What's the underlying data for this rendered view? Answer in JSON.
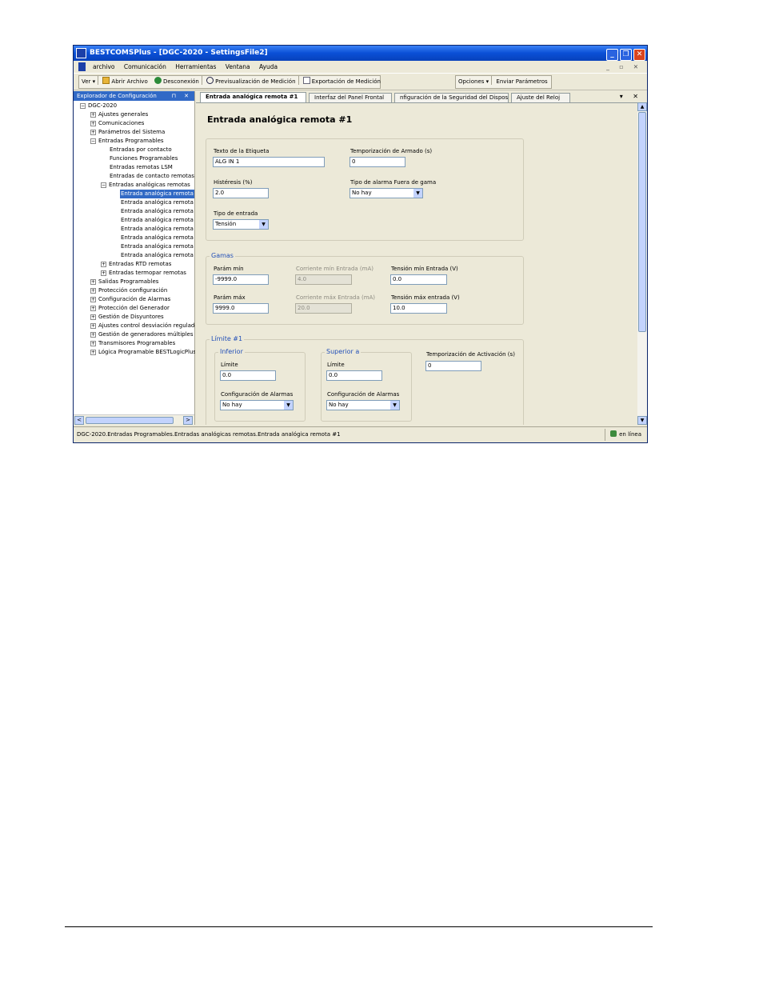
{
  "window": {
    "title": "BESTCOMSPlus - [DGC-2020 - SettingsFile2]",
    "controls": [
      "_",
      "❐",
      "✕"
    ]
  },
  "menu": {
    "items": [
      "archivo",
      "Comunicación",
      "Herramientas",
      "Ventana",
      "Ayuda"
    ],
    "mdi_controls": "_ ▫ ✕"
  },
  "toolbar": {
    "view": "Ver ▾",
    "open_file": "Abrir Archivo",
    "disconnect": "Desconexión",
    "preview": "Previsualización de Medición",
    "export": "Exportación de Medición",
    "options": "Opciones ▾",
    "send": "Enviar Parámetros"
  },
  "explorer": {
    "title": "Explorador de Configuración",
    "pin": "⊓ ✕",
    "nodes": [
      "DGC-2020",
      "Ajustes generales",
      "Comunicaciones",
      "Parámetros del Sistema",
      "Entradas Programables",
      "Entradas por contacto",
      "Funciones Programables",
      "Entradas remotas LSM",
      "Entradas de contacto remotas",
      "Entradas analógicas remotas",
      "Entrada analógica remota",
      "Entrada analógica remota",
      "Entrada analógica remota",
      "Entrada analógica remota",
      "Entrada analógica remota",
      "Entrada analógica remota",
      "Entrada analógica remota",
      "Entrada analógica remota",
      "Entradas RTD remotas",
      "Entradas termopar remotas",
      "Salidas Programables",
      "Protección configuración",
      "Configuración de Alarmas",
      "Protección del Generador",
      "Gestión de Disyuntores",
      "Ajustes control desviación regulado",
      "Gestión de generadores múltiples",
      "Transmisores Programables",
      "Lógica Programable BESTLogicPlus"
    ],
    "scroll_left": "<",
    "scroll_right": ">"
  },
  "tabs": {
    "items": [
      "Entrada analógica remota #1",
      "Interfaz del Panel Frontal",
      "nfiguración de la Seguridad del Dispositi",
      "Ajuste del Reloj"
    ],
    "controls": "▾ ✕"
  },
  "form": {
    "title": "Entrada analógica remota #1",
    "label_text_label": "Texto de la Etiqueta",
    "label_text_value": "ALG IN 1",
    "arm_delay_label": "Temporización de Armado (s)",
    "arm_delay_value": "0",
    "hysteresis_label": "Histéresis (%)",
    "hysteresis_value": "2.0",
    "oor_alarm_label": "Tipo de alarma Fuera de gama",
    "oor_alarm_value": "No hay",
    "input_type_label": "Tipo de entrada",
    "input_type_value": "Tensión",
    "ranges": {
      "title": "Gamas",
      "param_min_label": "Parám mín",
      "param_min_value": "-9999.0",
      "current_min_label": "Corriente mín Entrada (mA)",
      "current_min_value": "4.0",
      "voltage_min_label": "Tensión mín Entrada (V)",
      "voltage_min_value": "0.0",
      "param_max_label": "Parám máx",
      "param_max_value": "9999.0",
      "current_max_label": "Corriente máx Entrada (mA)",
      "current_max_value": "20.0",
      "voltage_max_label": "Tensión máx entrada (V)",
      "voltage_max_value": "10.0"
    },
    "limit1": {
      "title": "Límite #1",
      "lower_title": "Inferior",
      "lower_limit_label": "Límite",
      "lower_limit_value": "0.0",
      "lower_alarm_label": "Configuración de Alarmas",
      "lower_alarm_value": "No hay",
      "upper_title": "Superior a",
      "upper_limit_label": "Límite",
      "upper_limit_value": "0.0",
      "upper_alarm_label": "Configuración de Alarmas",
      "upper_alarm_value": "No hay",
      "activation_delay_label": "Temporización de Activación (s)",
      "activation_delay_value": "0"
    }
  },
  "status": {
    "path": "DGC-2020.Entradas Programables.Entradas analógicas remotas.Entrada analógica remota #1",
    "connection": "en línea"
  }
}
